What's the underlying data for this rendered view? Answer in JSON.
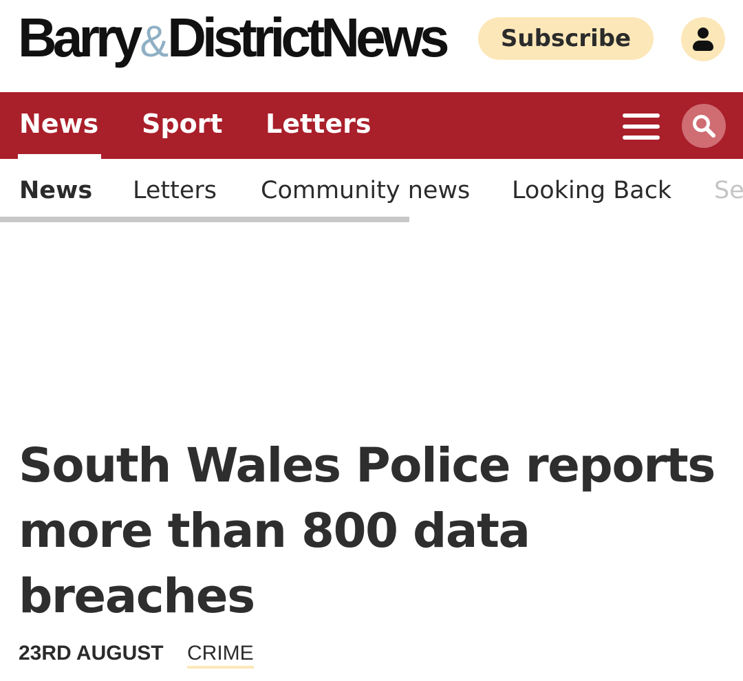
{
  "masthead": {
    "logo_part1": "Barry",
    "logo_amp": "&",
    "logo_part2": "District",
    "logo_part3": "News",
    "subscribe_label": "Subscribe",
    "account_icon": "user-icon"
  },
  "primary_nav": {
    "items": [
      {
        "label": "News",
        "active": true
      },
      {
        "label": "Sport",
        "active": false
      },
      {
        "label": "Letters",
        "active": false
      }
    ],
    "menu_icon": "hamburger-menu-icon",
    "search_icon": "search-icon"
  },
  "secondary_nav": {
    "items": [
      {
        "label": "News",
        "active": true
      },
      {
        "label": "Letters",
        "active": false
      },
      {
        "label": "Community news",
        "active": false
      },
      {
        "label": "Looking Back",
        "active": false
      },
      {
        "label": "Se",
        "active": false
      }
    ]
  },
  "article": {
    "headline": "South Wales Police reports more than 800 data breaches",
    "date": "23RD AUGUST",
    "category": "CRIME"
  },
  "colors": {
    "brand_red": "#a91f2a",
    "subscribe_bg": "#fce7b8",
    "logo_amp": "#8fb0c4",
    "search_bg": "#cf6d73"
  }
}
